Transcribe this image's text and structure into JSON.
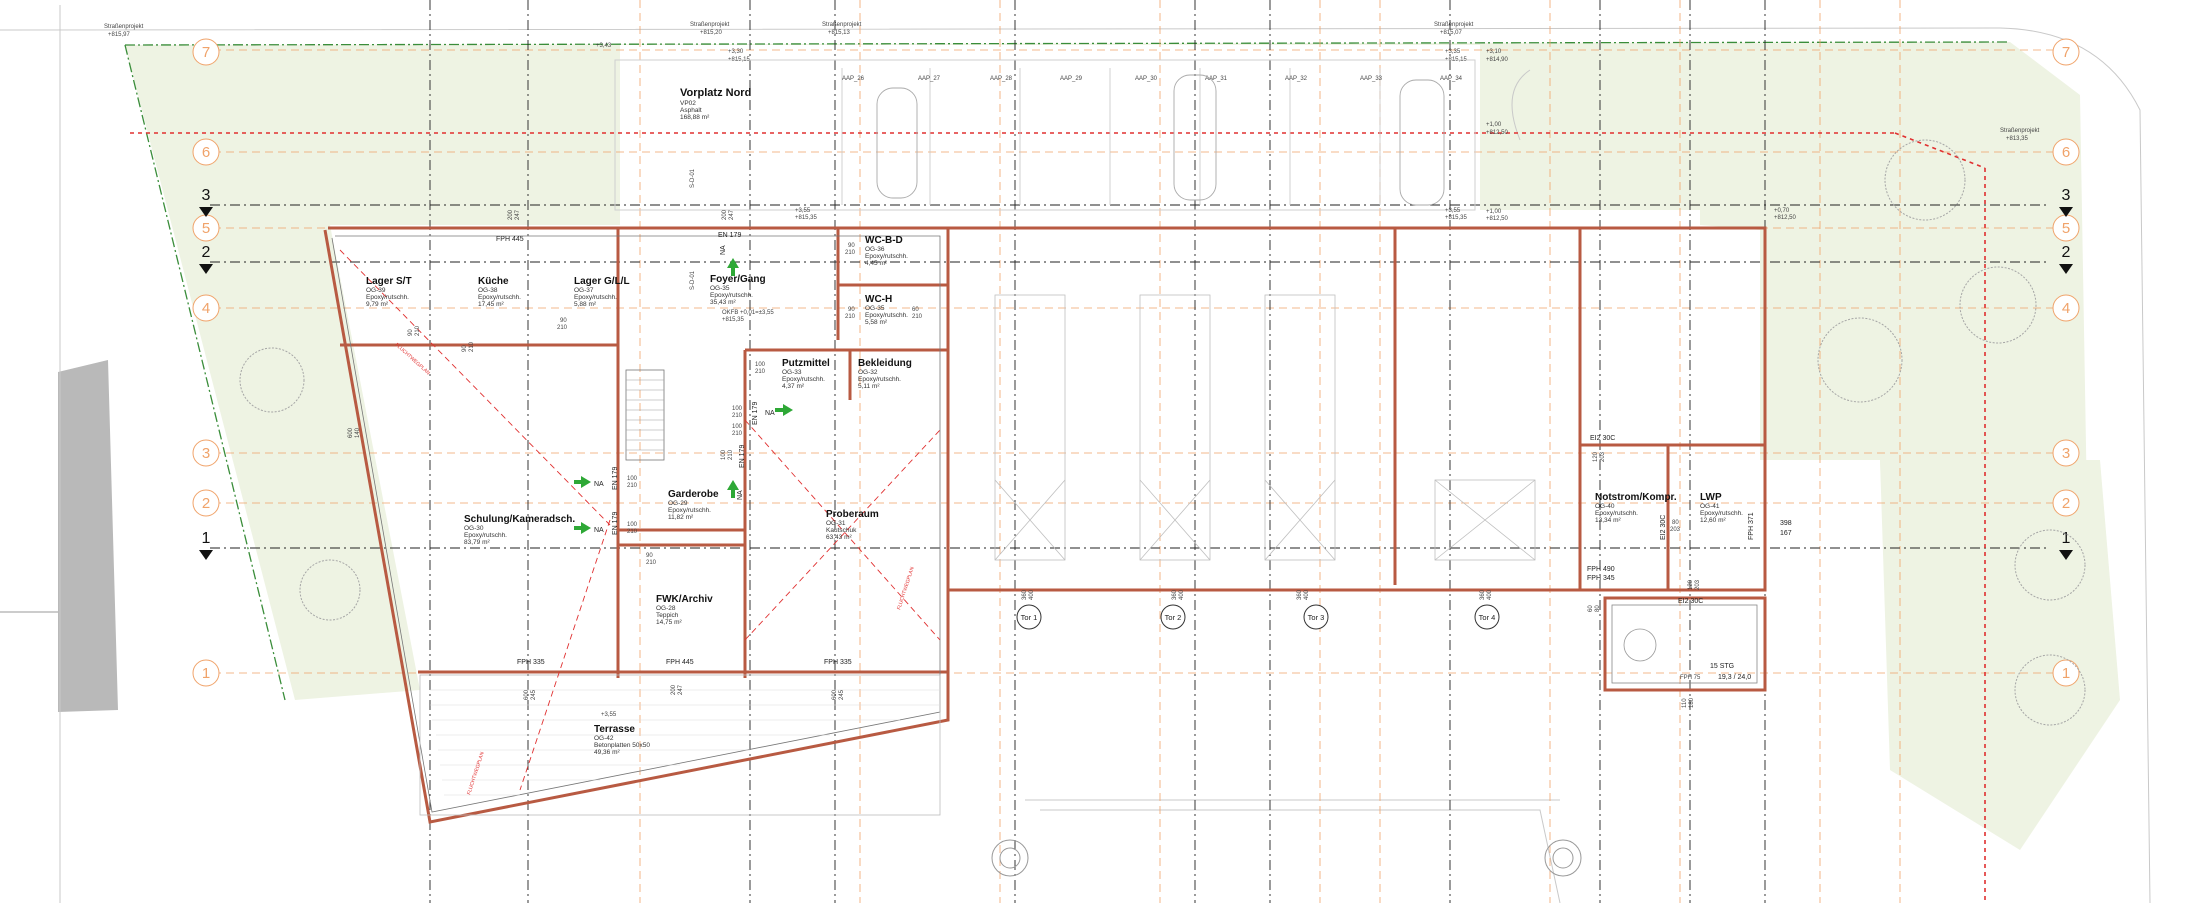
{
  "colors": {
    "wall": "#b85a42",
    "grid_orange": "#f0a36a",
    "grid_black": "#222222",
    "green_zone": "#eef3e3",
    "green_border": "#3a8d3a",
    "red_line": "#e03030",
    "arrow_green": "#2ea836",
    "tree": "#bdbdbd",
    "building_grey": "#b9b9b9"
  },
  "grid_rows": {
    "left_labels": [
      "7",
      "6",
      "5",
      "4",
      "3",
      "2",
      "1"
    ],
    "right_labels": [
      "7",
      "6",
      "5",
      "4",
      "3",
      "2",
      "1"
    ]
  },
  "axes": {
    "labels": [
      "3",
      "2",
      "1"
    ]
  },
  "top_notes": {
    "left_proj": "Straßenprojekt",
    "left_proj_val": "+815,97",
    "left_small": "+3,43",
    "mid1": "Straßenprojekt",
    "mid1_val": "+815,20",
    "mid2": "Straßenprojekt",
    "mid2_val": "+815,13",
    "mid_lv1": "+3,30",
    "mid_lv2": "+815,15",
    "right1": "Straßenprojekt",
    "right1_val": "+815,07",
    "right_lv1": "+3,35",
    "right_lv2": "+815,15",
    "right_lv3": "+3,10",
    "right_lv4": "+814,90",
    "right_lv5": "+1,00",
    "right_lv6": "+812,50",
    "far_right": "Straßenprojekt",
    "far_right_val": "+813,35"
  },
  "parking": [
    "AAP_26",
    "AAP_27",
    "AAP_28",
    "AAP_29",
    "AAP_30",
    "AAP_31",
    "AAP_32",
    "AAP_33",
    "AAP_34"
  ],
  "vorplatz": {
    "title": "Vorplatz Nord",
    "code": "VP02",
    "surface": "Asphalt",
    "area": "168,88 m²"
  },
  "stairs_label": "S-D-01",
  "rooms": [
    {
      "name": "Lager S/T",
      "code": "OG-39",
      "surface": "Epoxy/rutschh.",
      "area": "9,79 m²"
    },
    {
      "name": "Küche",
      "code": "OG-38",
      "surface": "Epoxy/rutschh.",
      "area": "17,45 m²"
    },
    {
      "name": "Lager G/L/L",
      "code": "OG-37",
      "surface": "Epoxy/rutschh.",
      "area": "5,88 m²"
    },
    {
      "name": "Foyer/Gang",
      "code": "OG-35",
      "surface": "Epoxy/rutschh.",
      "area": "35,43 m²"
    },
    {
      "name": "WC-B-D",
      "code": "OG-36",
      "surface": "Epoxy/rutschh.",
      "area": "4,45 m²"
    },
    {
      "name": "WC-H",
      "code": "OG-35",
      "surface": "Epoxy/rutschh.",
      "area": "5,58 m²"
    },
    {
      "name": "Putzmittel",
      "code": "OG-33",
      "surface": "Epoxy/rutschh.",
      "area": "4,37 m²"
    },
    {
      "name": "Bekleidung",
      "code": "OG-32",
      "surface": "Epoxy/rutschh.",
      "area": "5,11 m²"
    },
    {
      "name": "Garderobe",
      "code": "OG-29",
      "surface": "Epoxy/rutschh.",
      "area": "11,82 m²"
    },
    {
      "name": "Schulung/Kameradsch.",
      "code": "OG-30",
      "surface": "Epoxy/rutschh.",
      "area": "83,79 m²"
    },
    {
      "name": "Proberaum",
      "code": "OG-31",
      "surface": "Kautschuk",
      "area": "63,43 m²"
    },
    {
      "name": "FWK/Archiv",
      "code": "OG-28",
      "surface": "Teppich",
      "area": "14,75 m²"
    },
    {
      "name": "Terrasse",
      "code": "OG-42",
      "surface": "Betonplatten 50x50",
      "area": "49,36 m²"
    },
    {
      "name": "Notstrom/Kompr.",
      "code": "OG-40",
      "surface": "Epoxy/rutschh.",
      "area": "13,34 m²"
    },
    {
      "name": "LWP",
      "code": "OG-41",
      "surface": "Epoxy/rutschh.",
      "area": "12,60 m²"
    }
  ],
  "labels": {
    "fph445_top": "FPH 445",
    "fph335_l": "FPH 335",
    "fph445_b": "FPH 445",
    "fph335_r": "FPH 335",
    "en179_top": "EN 179",
    "en179_a": "EN 179",
    "en179_b": "EN 179",
    "en179_c": "EN 179",
    "en179_d": "EN 179",
    "na": "NA",
    "oktfb": "OKFB +0,01=±3,55",
    "oktfb2": "+815,35",
    "lv_355": "+3,55",
    "lv_81535": "+815,35",
    "ei30c_a": "EI2 30C",
    "ei30c_b": "EI2 30C",
    "ei30c_c": "EI2 30C",
    "fph490": "FPH 490",
    "fph345": "FPH 345",
    "fph371": "FPH 371",
    "stg": "15 STG",
    "stg_dim": "19,3 / 24,0",
    "fph_s": "FPH 75",
    "dim_398": "398",
    "dim_167": "167",
    "terr_lv": "+3,55",
    "flucht": "FLUCHTWEGPLAN",
    "lv_070": "+0,70",
    "lv_81250": "+812,50"
  },
  "doors": {
    "d90": "90",
    "d210": "210",
    "d100": "100",
    "d80": "80",
    "d120": "120",
    "d60": "60",
    "d360": "360",
    "d400": "400",
    "d203": "203",
    "d110": "110",
    "d180": "180",
    "d200": "200",
    "d247": "247",
    "d245": "245",
    "d600": "600",
    "d140": "140"
  },
  "gates": [
    "Tor 1",
    "Tor 2",
    "Tor 3",
    "Tor 4"
  ]
}
